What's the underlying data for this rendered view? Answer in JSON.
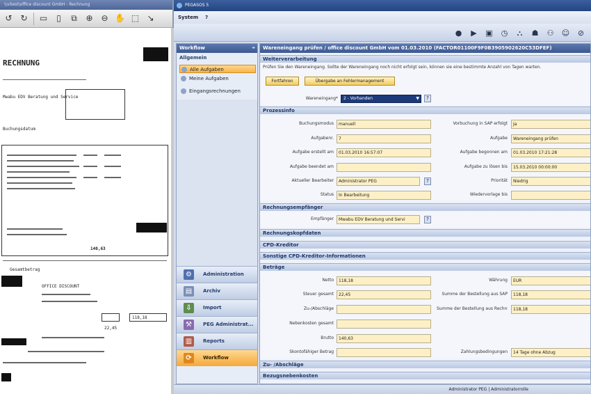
{
  "viewer": {
    "title": "\\\\vitest\\office discount GmbH - Rechnung",
    "doc_texts": {
      "t1": "RECHNUNG",
      "t2": "Mwabu EDV Beratung und Service",
      "t3": "Buchungsdatum",
      "t4": "OFFICE DISCOUNT",
      "t5": "140,63",
      "t6": "Gesamtbetrag",
      "t7": "118,18",
      "t8": "22,45"
    }
  },
  "app": {
    "title": "PEGASOS 5",
    "menu": [
      "System",
      "?"
    ]
  },
  "nav": {
    "header": "Workflow",
    "group": "Allgemein",
    "items": [
      "Alle Aufgaben",
      "Meine Aufgaben",
      "Eingangsrechnungen"
    ],
    "buttons": [
      "Administration",
      "Archiv",
      "Import",
      "PEG Administrat...",
      "Reports",
      "Workflow"
    ]
  },
  "content": {
    "title": "Wareneingang prüfen / office discount GmbH  vom 01.03.2010 (FACTOR01100F9F0B3905902620C53DFEF)",
    "weiter": {
      "header": "Weiterverarbeitung",
      "hint": "Prüfen Sie den Wareneingang. Sollte der Wareneingang noch nicht erfolgt sein, können sie eine bestimmte Anzahl von Tagen warten.",
      "btn_fortfahren": "Fortfahren",
      "btn_uebergabe": "Übergabe an Fehlermanagement",
      "we_label": "Wareneingang*",
      "we_value": "2 - Vorhanden"
    },
    "prozess": {
      "header": "Prozessinfo",
      "buchungsmodus_label": "Buchungsmodus",
      "buchungsmodus": "manuell",
      "aufgabenr_label": "Aufgabenr.",
      "aufgabenr": "7",
      "erstellt_label": "Aufgabe erstellt am",
      "erstellt": "01.03.2010 16:57:07",
      "beendet_label": "Aufgabe beendet am",
      "beendet": "",
      "bearbeiter_label": "Aktueller Bearbeiter",
      "bearbeiter": "Administrator PEG",
      "status_label": "Status",
      "status": "In Bearbeitung",
      "vorbuchung_label": "Vorbuchung in SAP erfolgt",
      "vorbuchung": "Ja",
      "aufgabe_label": "Aufgabe",
      "aufgabe": "Wareneingang prüfen",
      "begonnen_label": "Aufgabe begonnen am",
      "begonnen": "01.03.2010 17:21:28",
      "zuloesen_label": "Aufgabe zu lösen bis",
      "zuloesen": "15.03.2010 00:00:00",
      "prioritaet_label": "Priorität",
      "prioritaet": "Niedrig",
      "wiedervorlage_label": "Wiedervorlage bis",
      "wiedervorlage": ""
    },
    "empfaenger": {
      "header": "Rechnungsempfänger",
      "label": "Empfänger",
      "value": "Mwabu EDV Beratung und Servi"
    },
    "kopfdaten_header": "Rechnungskopfdaten",
    "cpd_header": "CPD-Kreditor",
    "sonstige_header": "Sonstige CPD-Kreditor-Informationen",
    "betraege": {
      "header": "Beträge",
      "netto_label": "Netto",
      "netto": "118,18",
      "steuer_label": "Steuer gesamt",
      "steuer": "22,45",
      "zu_label": "Zu-/Abschläge",
      "zu": "",
      "neben_label": "Nebenkosten gesamt",
      "neben": "",
      "brutto_label": "Brutto",
      "brutto": "140,63",
      "skonto_label": "Skontofähiger Betrag",
      "skonto": "",
      "waehrung_label": "Währung",
      "waehrung": "EUR",
      "sum_sap_label": "Summe der Bestellung aus SAP",
      "sum_sap": "118,18",
      "sum_rech_label": "Summe der Bestellung aus Rechnung",
      "sum_rech": "118,18",
      "zahlung_label": "Zahlungsbedingungen",
      "zahlung": "14 Tage ohne Abzug"
    },
    "zuab_header": "Zu- /Abschläge",
    "bezug_header": "Bezugsnebenkosten"
  },
  "statusbar": "Administrator PEG | Administratorrolle",
  "colors": {
    "accent": "#f4a93a",
    "header": "#3c5891",
    "field": "#fdf0c6"
  }
}
